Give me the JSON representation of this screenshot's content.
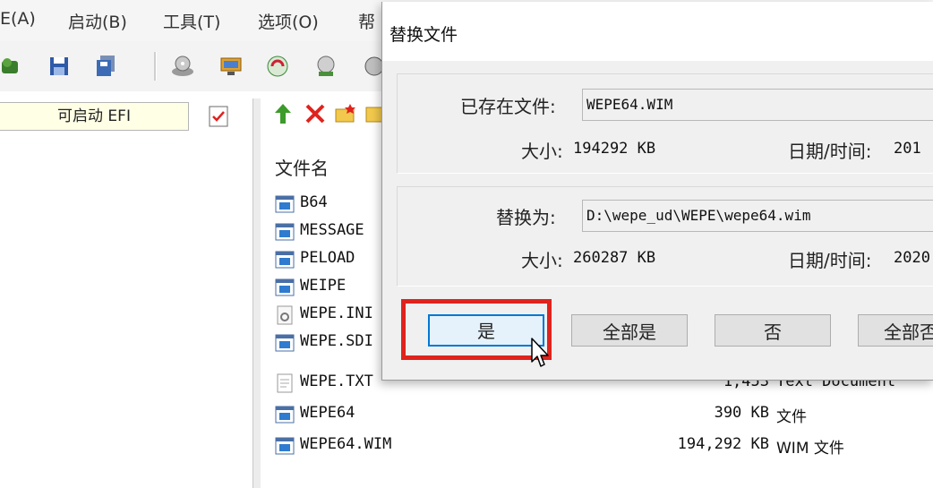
{
  "menubar": {
    "items": [
      "E(A)",
      "启动(B)",
      "工具(T)",
      "选项(O)",
      "帮"
    ]
  },
  "toolbar": {
    "icons": [
      "tree-icon",
      "save-icon",
      "save-as-icon",
      "burn-disc-icon",
      "virtual-drive-icon",
      "convert-icon",
      "properties-icon",
      "extra-icon"
    ]
  },
  "left_pane": {
    "boot_label": "可启动 EFI"
  },
  "right_pane": {
    "column_filename": "文件名",
    "files": [
      {
        "name": "B64",
        "size": "",
        "type": "",
        "icon": "app-icon"
      },
      {
        "name": "MESSAGE",
        "size": "",
        "type": "",
        "icon": "app-icon"
      },
      {
        "name": "PELOAD",
        "size": "",
        "type": "",
        "icon": "app-icon"
      },
      {
        "name": "WEIPE",
        "size": "",
        "type": "",
        "icon": "app-icon"
      },
      {
        "name": "WEPE.INI",
        "size": "",
        "type": "",
        "icon": "settings-file-icon"
      },
      {
        "name": "WEPE.SDI",
        "size": "",
        "type": "",
        "icon": "app-icon"
      },
      {
        "name": "WEPE.TXT",
        "size": "1,453",
        "type": "Text Document",
        "icon": "text-file-icon"
      },
      {
        "name": "WEPE64",
        "size": "390 KB",
        "type": "文件",
        "icon": "app-icon"
      },
      {
        "name": "WEPE64.WIM",
        "size": "194,292 KB",
        "type": "WIM 文件",
        "icon": "app-icon"
      }
    ]
  },
  "dialog": {
    "title": "替换文件",
    "existing": {
      "label": "已存在文件:",
      "value": "WEPE64.WIM",
      "size_label": "大小:",
      "size_value": "194292 KB",
      "datetime_label": "日期/时间:",
      "datetime_value": "201"
    },
    "replace": {
      "label": "替换为:",
      "value": "D:\\wepe_ud\\WEPE\\wepe64.wim",
      "size_label": "大小:",
      "size_value": "260287 KB",
      "datetime_label": "日期/时间:",
      "datetime_value": "2020"
    },
    "buttons": {
      "yes": "是",
      "yes_all": "全部是",
      "no": "否",
      "no_all": "全部否"
    }
  },
  "colors": {
    "highlight": "#e0231d",
    "focus": "#0078d7"
  }
}
